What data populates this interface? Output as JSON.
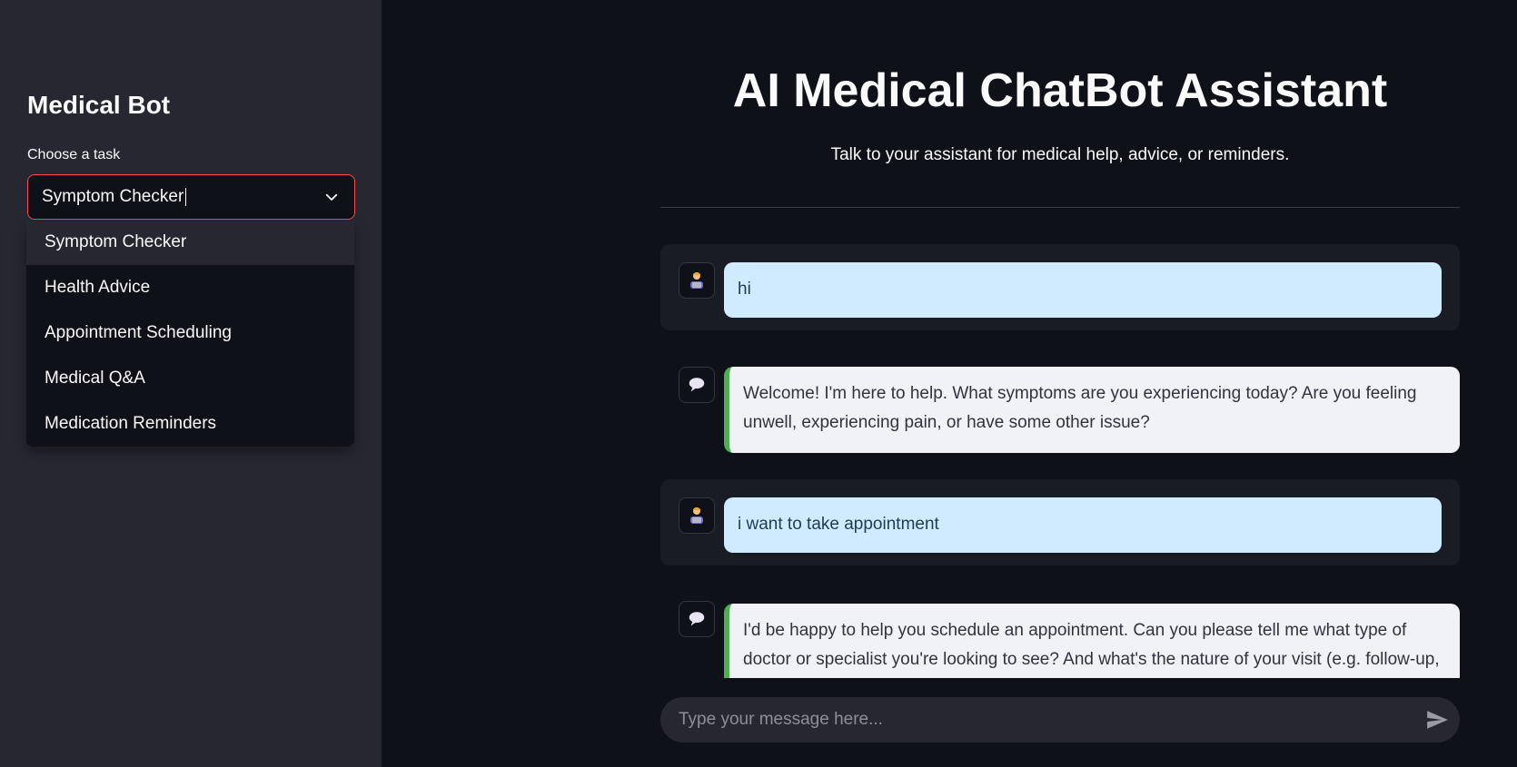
{
  "sidebar": {
    "title": "Medical Bot",
    "select_label": "Choose a task",
    "selected_value": "Symptom Checker",
    "options": [
      "Symptom Checker",
      "Health Advice",
      "Appointment Scheduling",
      "Medical Q&A",
      "Medication Reminders"
    ]
  },
  "main": {
    "title": "AI Medical ChatBot Assistant",
    "subtitle": "Talk to your assistant for medical help, advice, or reminders."
  },
  "messages": [
    {
      "role": "user",
      "avatar": "user-avatar-icon",
      "text": "hi"
    },
    {
      "role": "assistant",
      "avatar": "chat-bubble-icon",
      "text": "Welcome! I'm here to help. What symptoms are you experiencing today? Are you feeling unwell, experiencing pain, or have some other issue?"
    },
    {
      "role": "user",
      "avatar": "user-avatar-icon",
      "text": "i want to take appointment"
    },
    {
      "role": "assistant",
      "avatar": "chat-bubble-icon",
      "text": "I'd be happy to help you schedule an appointment. Can you please tell me what type of doctor or specialist you're looking to see? And what's the nature of your visit (e.g. follow-up,"
    }
  ],
  "chat_input": {
    "placeholder": "Type your message here...",
    "send_icon": "send-icon"
  },
  "colors": {
    "accent": "#ff4b4b",
    "user_bubble": "#d0ebff",
    "bot_bubble": "#f0f2f6",
    "bot_border": "#4caf50"
  }
}
